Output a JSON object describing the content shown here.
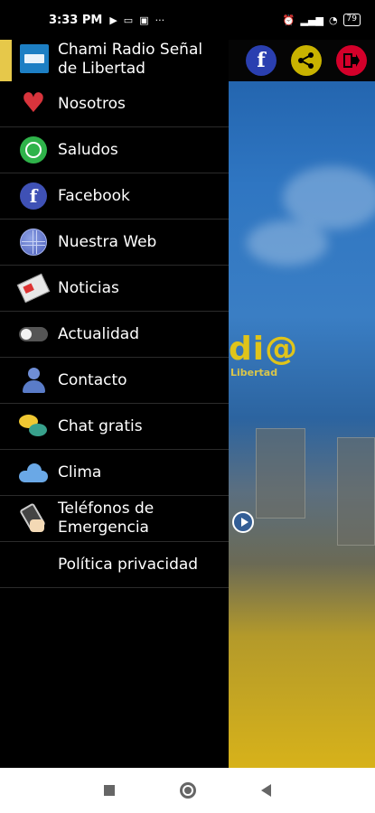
{
  "status_bar": {
    "time": "3:33 PM",
    "left_icons": [
      "play-icon",
      "laptop-icon",
      "youtube-icon",
      "more-icon"
    ],
    "more_text": "···",
    "battery": "79"
  },
  "background_app": {
    "logo_text": "di@",
    "logo_subtitle": "Libertad"
  },
  "drawer": {
    "title": "Chami Radio Señal de Libertad",
    "accent_color": "#e6c84a",
    "items": [
      {
        "label": "Nosotros",
        "icon": "heart-icon"
      },
      {
        "label": "Saludos",
        "icon": "whatsapp-icon"
      },
      {
        "label": "Facebook",
        "icon": "facebook-icon"
      },
      {
        "label": "Nuestra Web",
        "icon": "globe-icon"
      },
      {
        "label": "Noticias",
        "icon": "newspaper-icon"
      },
      {
        "label": "Actualidad",
        "icon": "toggle-icon"
      },
      {
        "label": "Contacto",
        "icon": "contact-icon"
      },
      {
        "label": "Chat gratis",
        "icon": "chat-icon"
      },
      {
        "label": "Clima",
        "icon": "cloud-icon"
      },
      {
        "label": "Teléfonos de Emergencia",
        "icon": "phone-icon"
      },
      {
        "label": "Política privacidad",
        "icon": ""
      }
    ]
  },
  "top_actions": {
    "facebook_glyph": "f",
    "colors": {
      "facebook": "#2a3fb0",
      "share": "#c9b300",
      "exit": "#d4002a"
    }
  },
  "navbar": {
    "buttons": [
      "recents-button",
      "home-button",
      "back-button"
    ]
  }
}
